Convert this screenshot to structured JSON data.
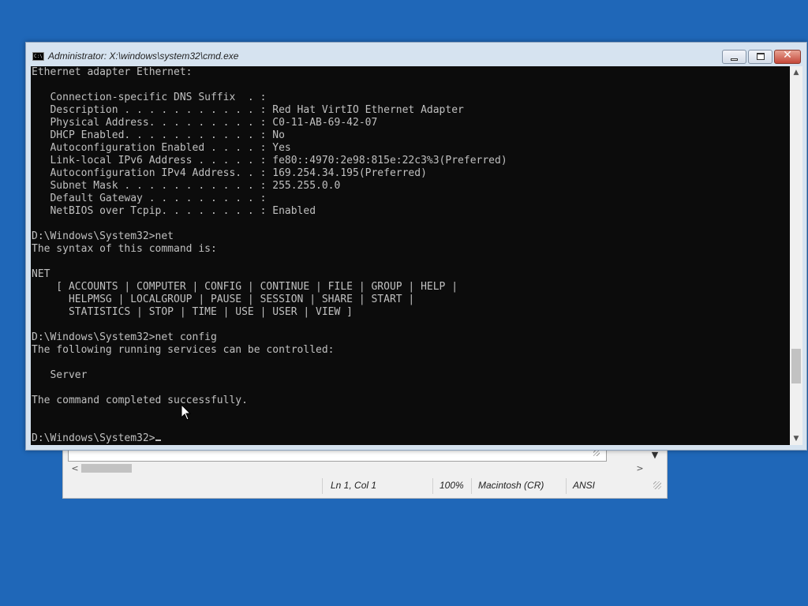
{
  "notepad": {
    "status": {
      "position": "Ln 1, Col 1",
      "zoom": "100%",
      "line_ending": "Macintosh (CR)",
      "encoding": "ANSI"
    }
  },
  "cmd": {
    "title": "Administrator: X:\\windows\\system32\\cmd.exe",
    "icon_text": "C:\\",
    "prompt": "D:\\Windows\\System32>",
    "lines": [
      "Ethernet adapter Ethernet:",
      "",
      "   Connection-specific DNS Suffix  . :",
      "   Description . . . . . . . . . . . : Red Hat VirtIO Ethernet Adapter",
      "   Physical Address. . . . . . . . . : C0-11-AB-69-42-07",
      "   DHCP Enabled. . . . . . . . . . . : No",
      "   Autoconfiguration Enabled . . . . : Yes",
      "   Link-local IPv6 Address . . . . . : fe80::4970:2e98:815e:22c3%3(Preferred)",
      "   Autoconfiguration IPv4 Address. . : 169.254.34.195(Preferred)",
      "   Subnet Mask . . . . . . . . . . . : 255.255.0.0",
      "   Default Gateway . . . . . . . . . :",
      "   NetBIOS over Tcpip. . . . . . . . : Enabled",
      "",
      "D:\\Windows\\System32>net",
      "The syntax of this command is:",
      "",
      "NET",
      "    [ ACCOUNTS | COMPUTER | CONFIG | CONTINUE | FILE | GROUP | HELP |",
      "      HELPMSG | LOCALGROUP | PAUSE | SESSION | SHARE | START |",
      "      STATISTICS | STOP | TIME | USE | USER | VIEW ]",
      "",
      "D:\\Windows\\System32>net config",
      "The following running services can be controlled:",
      "",
      "   Server",
      "",
      "The command completed successfully.",
      "",
      ""
    ],
    "scroll_position": 0.85
  },
  "colors": {
    "desktop": "#1f67b8",
    "console_bg": "#0c0c0c",
    "console_fg": "#c0c0c0",
    "close_button": "#c4483a"
  },
  "icons": {
    "app": "cmd-icon",
    "minimize": "minimize-icon",
    "maximize": "maximize-icon",
    "close": "close-icon",
    "pointer": "mouse-pointer-icon"
  }
}
